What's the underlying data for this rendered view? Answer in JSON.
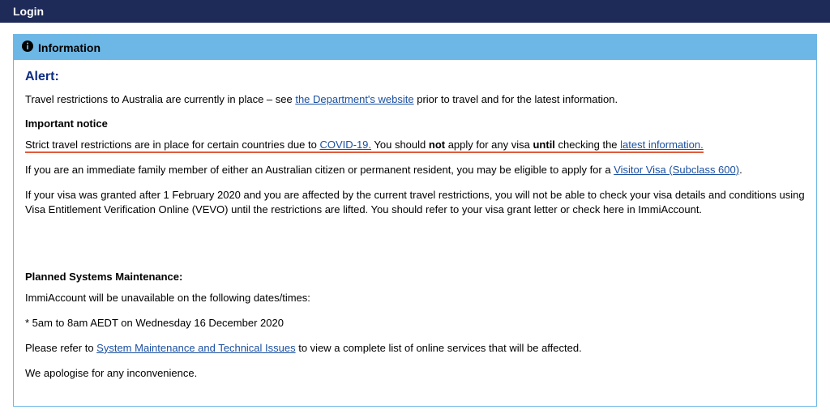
{
  "header": {
    "title": "Login"
  },
  "info": {
    "panel_title": "Information",
    "alert_heading": "Alert:",
    "p1_part1": "Travel restrictions to Australia are currently in place – see ",
    "p1_link": "the Department's website",
    "p1_part2": " prior to travel and for the latest information.",
    "important_heading": "Important notice",
    "strict_p1": "Strict travel restrictions are in place for certain countries due to ",
    "strict_link1": "COVID-19.",
    "strict_p2": " You should ",
    "strict_bold1": "not",
    "strict_p3": " apply for any visa ",
    "strict_bold2": "until",
    "strict_p4": " checking the ",
    "strict_link2": "latest information.",
    "family_p1": "If you are an immediate family member of either an Australian citizen or permanent resident, you may be eligible to apply for a ",
    "family_link": "Visitor Visa (Subclass 600)",
    "family_p2": ".",
    "visa_p": "If your visa was granted after 1 February 2020 and you are affected by the current travel restrictions, you will not be able to check your visa details and conditions using Visa Entitlement Verification Online (VEVO) until the restrictions are lifted. You should refer to your visa grant letter or check here in ImmiAccount.",
    "maint_heading": "Planned Systems Maintenance:",
    "maint_p1": "ImmiAccount will be unavailable on the following dates/times:",
    "maint_p2": "* 5am to 8am AEDT on Wednesday 16 December 2020",
    "maint_p3a": "Please refer to ",
    "maint_link": "System Maintenance and Technical Issues",
    "maint_p3b": " to view a complete list of online services that will be affected.",
    "maint_p4": "We apologise for any inconvenience."
  }
}
